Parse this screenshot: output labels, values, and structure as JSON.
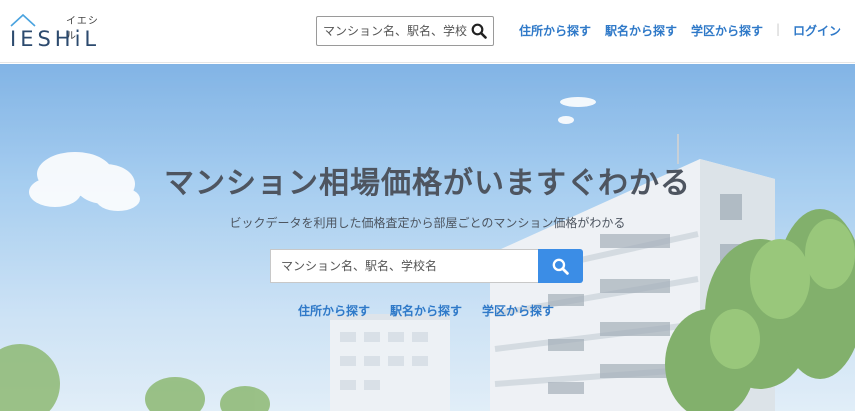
{
  "logo": {
    "main": "IESHiL",
    "sub": "イエシル"
  },
  "header": {
    "search_placeholder": "マンション名、駅名、学校名",
    "nav": [
      {
        "label": "住所から探す"
      },
      {
        "label": "駅名から探す"
      },
      {
        "label": "学区から探す"
      }
    ],
    "separator": "|",
    "login_label": "ログイン"
  },
  "hero": {
    "title": "マンション相場価格がいますぐわかる",
    "subtitle": "ビックデータを利用した価格査定から部屋ごとのマンション価格がわかる",
    "search_placeholder": "マンション名、駅名、学校名",
    "links": [
      {
        "label": "住所から探す"
      },
      {
        "label": "駅名から探す"
      },
      {
        "label": "学区から探す"
      }
    ]
  },
  "colors": {
    "accent": "#3b8de6",
    "link": "#2f79c8",
    "title": "#4e5560"
  }
}
